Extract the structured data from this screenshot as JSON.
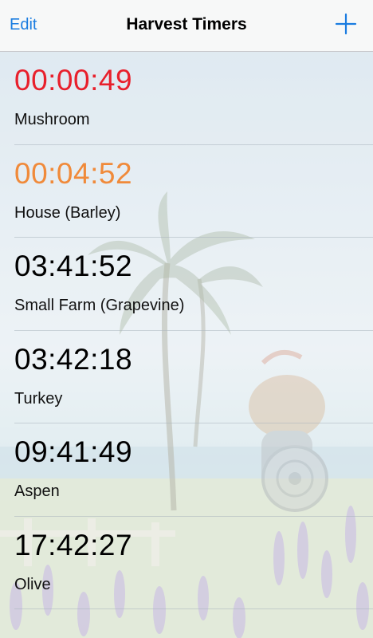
{
  "navbar": {
    "edit_label": "Edit",
    "title": "Harvest Timers",
    "add_icon": "plus-icon"
  },
  "colors": {
    "accent": "#1a7ce0",
    "urgent": "#e8202c",
    "warning": "#f08a3a",
    "normal": "#000000"
  },
  "timers": [
    {
      "time": "00:00:49",
      "name": "Mushroom",
      "status": "urgent"
    },
    {
      "time": "00:04:52",
      "name": "House (Barley)",
      "status": "warning"
    },
    {
      "time": "03:41:52",
      "name": "Small Farm (Grapevine)",
      "status": "normal"
    },
    {
      "time": "03:42:18",
      "name": "Turkey",
      "status": "normal"
    },
    {
      "time": "09:41:49",
      "name": "Aspen",
      "status": "normal"
    },
    {
      "time": "17:42:27",
      "name": "Olive",
      "status": "normal"
    }
  ]
}
